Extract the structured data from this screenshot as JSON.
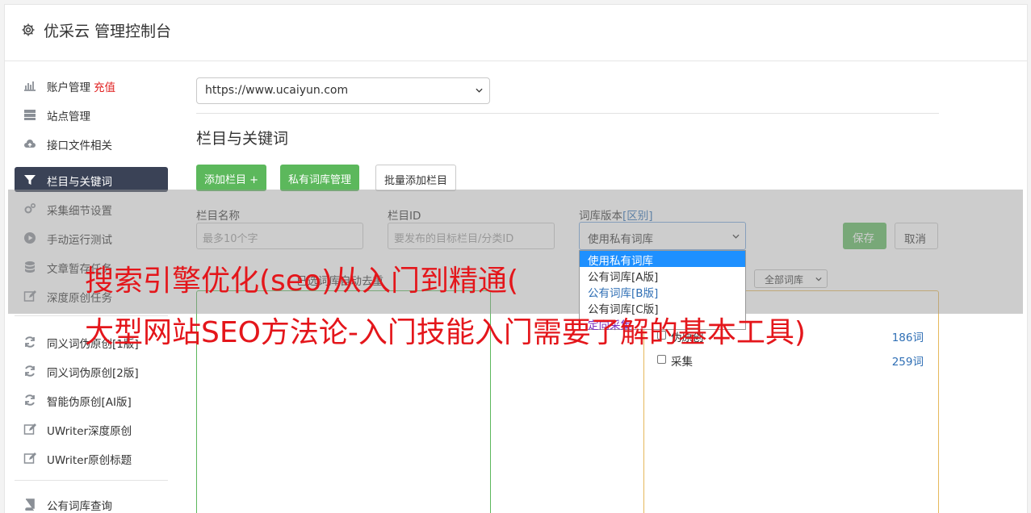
{
  "header": {
    "title": "优采云 管理控制台",
    "icon": "gear-icon"
  },
  "sidebar": {
    "items": [
      {
        "label": "账户管理",
        "extra": "充值",
        "icon": "bar-chart-icon"
      },
      {
        "label": "站点管理",
        "icon": "server-icon"
      },
      {
        "label": "接口文件相关",
        "icon": "cloud-upload-icon"
      },
      {
        "label": "栏目与关键词",
        "icon": "filter-icon",
        "active": true
      },
      {
        "label": "采集细节设置",
        "icon": "gears-icon"
      },
      {
        "label": "手动运行测试",
        "icon": "play-circle-icon"
      },
      {
        "label": "文章暂存任务",
        "icon": "database-icon"
      },
      {
        "label": "深度原创任务",
        "icon": "edit-icon"
      },
      {
        "label": "同义词伪原创[1版]",
        "icon": "refresh-icon"
      },
      {
        "label": "同义词伪原创[2版]",
        "icon": "refresh-icon"
      },
      {
        "label": "智能伪原创[AI版]",
        "icon": "refresh-icon"
      },
      {
        "label": "UWriter深度原创",
        "icon": "edit-icon"
      },
      {
        "label": "UWriter原创标题",
        "icon": "edit-icon"
      },
      {
        "label": "公有词库查询",
        "icon": "book-icon"
      }
    ]
  },
  "main": {
    "site_select": {
      "value": "https://www.ucaiyun.com"
    },
    "section_title": "栏目与关键词",
    "buttons": {
      "add_column": "添加栏目 +",
      "private_lib": "私有词库管理",
      "batch_add": "批量添加栏目"
    },
    "form": {
      "name_label": "栏目名称",
      "name_placeholder": "最多10个字",
      "id_label": "栏目ID",
      "id_placeholder": "要发布的目标栏目/分类ID",
      "lib_label": "词库版本",
      "lib_label_link": "[区别]",
      "lib_value": "使用私有词库",
      "save": "保存",
      "cancel": "取消"
    },
    "dropdown_options": [
      "使用私有词库",
      "公有词库[A版]",
      "公有词库[B版]",
      "公有词库[C版]",
      "定向采集"
    ],
    "below_label": "已选词库自动去重",
    "all_lib_select": "全部词库",
    "lib_list": [
      {
        "name": "伪原创",
        "count": "186词"
      },
      {
        "name": "采集",
        "count": "259词"
      }
    ]
  },
  "watermark": {
    "line1": "搜索引擎优化(seo)从入门到精通(",
    "line2": "大型网站SEO方法论-入门技能入门需要了解的基本工具)"
  },
  "colors": {
    "accent_green": "#5cb85c",
    "active_nav": "#3a4256",
    "link_blue": "#2f6fb5",
    "watermark_red": "#e4161b"
  }
}
